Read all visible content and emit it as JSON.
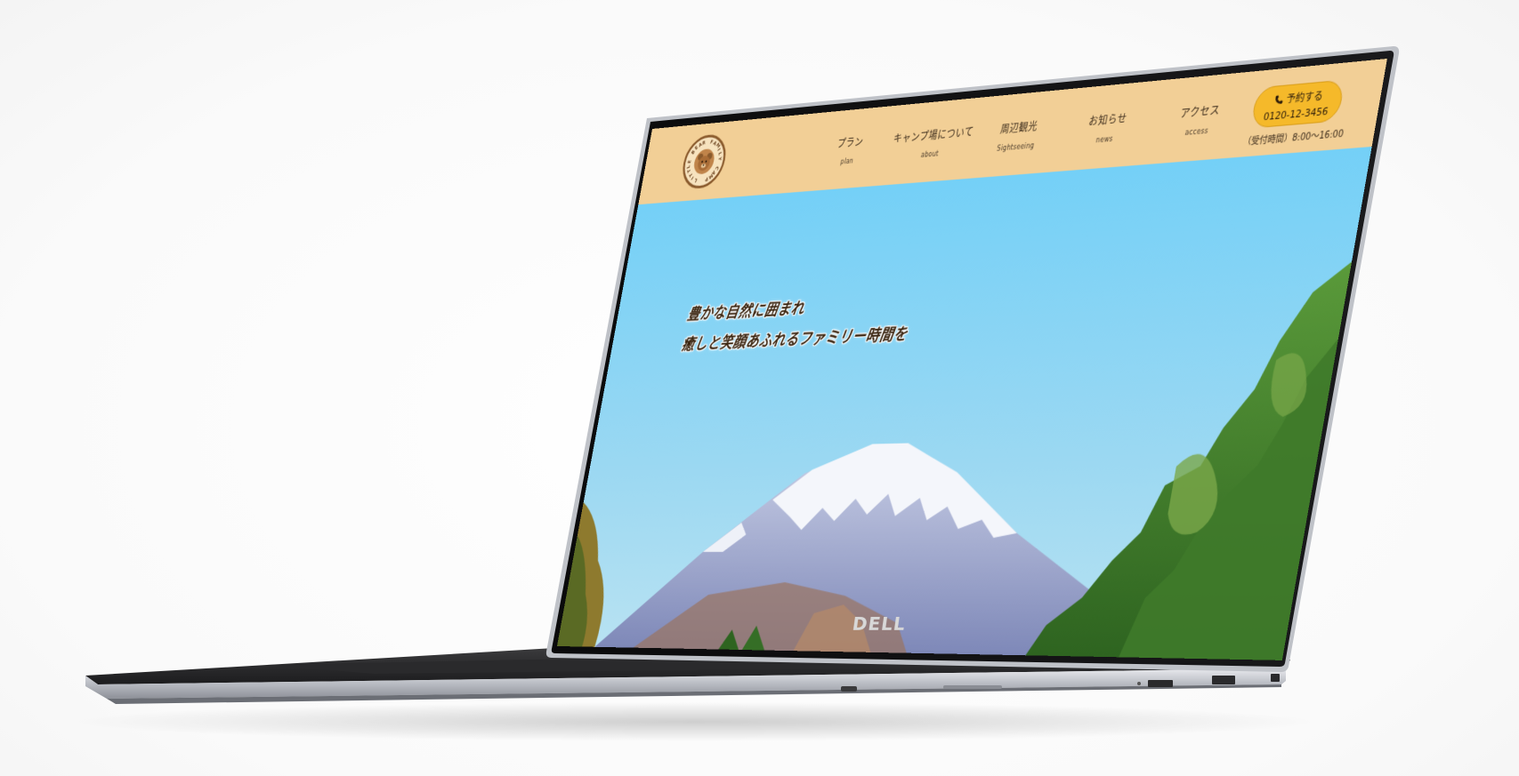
{
  "site": {
    "logo_text": "LITTLE BEAR FAMILY CAMP",
    "nav": [
      {
        "label": "プラン",
        "sub": "plan"
      },
      {
        "label": "キャンプ場について",
        "sub": "about"
      },
      {
        "label": "周辺観光",
        "sub": "Sightseeing"
      },
      {
        "label": "お知らせ",
        "sub": "news"
      },
      {
        "label": "アクセス",
        "sub": "access"
      }
    ],
    "reserve": {
      "label": "予約する",
      "phone": "0120-12-3456",
      "hours": "（受付時間）8:00〜16:00"
    },
    "hero": {
      "line1": "豊かな自然に囲まれ",
      "line2": "癒しと笑顔あふれるファミリー時間を"
    }
  },
  "device": {
    "brand": "DELL"
  },
  "colors": {
    "header_bg": "#f2cf96",
    "reserve_button": "#f5b92a",
    "sky": "#7fd2f4",
    "text_dark": "#3a2510"
  },
  "icons": {
    "reserve": "phone-icon",
    "logo": "bear-icon"
  }
}
